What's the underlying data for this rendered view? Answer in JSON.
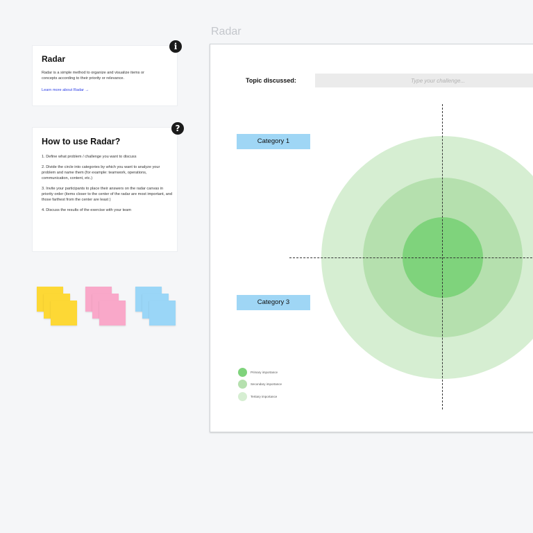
{
  "frame": {
    "title": "Radar"
  },
  "info_card": {
    "title": "Radar",
    "description": "Radar is a simple method to organize and visualize items or concepts according to their priority or relevance.",
    "link_text": "Learn more about Radar →",
    "badge_icon": "info-icon",
    "badge_glyph": "i"
  },
  "howto_card": {
    "title": "How to use Radar?",
    "badge_icon": "question-icon",
    "badge_glyph": "?",
    "steps": [
      "1. Define what problem / challenge you want to discuss",
      "2. Divide the circle into categories by which you want to analyze your problem and name them (for example: teamwork, operations, communication, content, etc.)",
      "3. Invite your participants to place their answers on the radar canvas in priority order (items closer to the center of the radar are most important, and those farthest from the center are least )",
      "4. Discuss the results of the exercise with your team"
    ]
  },
  "sticky_notes": [
    {
      "color": "#fdd835",
      "name": "yellow"
    },
    {
      "color": "#f9a8c9",
      "name": "pink"
    },
    {
      "color": "#9ad6f7",
      "name": "blue"
    }
  ],
  "board": {
    "topic_label": "Topic discussed:",
    "topic_placeholder": "Type your challenge...",
    "categories": [
      "Category 1",
      "Category 3"
    ],
    "legend": [
      {
        "label": "Primary importance",
        "color": "#7fd37c"
      },
      {
        "label": "Secondary importance",
        "color": "#b5e0ae"
      },
      {
        "label": "Tertiary importance",
        "color": "#d6eed2"
      }
    ]
  }
}
